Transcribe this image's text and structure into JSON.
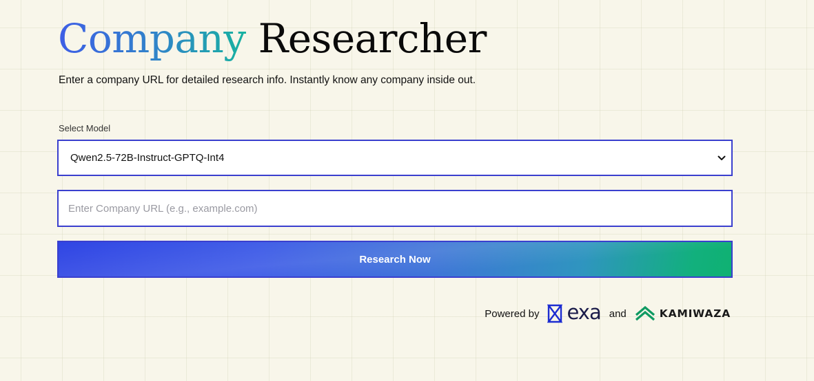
{
  "title": {
    "accent": "Company",
    "main": "Researcher"
  },
  "subtitle": "Enter a company URL for detailed research info. Instantly know any company inside out.",
  "model_select": {
    "label": "Select Model",
    "selected": "Qwen2.5-72B-Instruct-GPTQ-Int4"
  },
  "url_input": {
    "value": "",
    "placeholder": "Enter Company URL (e.g., example.com)"
  },
  "research_button": {
    "label": "Research Now"
  },
  "footer": {
    "powered_by": "Powered by",
    "exa_wordmark": "exa",
    "and": "and",
    "kamiwaza_wordmark": "KAMIWAZA"
  },
  "icons": {
    "select_chevron": "chevron-down-icon",
    "exa_logo": "exa-logo-icon",
    "kamiwaza_logo": "kamiwaza-logo-icon"
  },
  "colors": {
    "background": "#f8f6ea",
    "border_accent": "#3a3fce",
    "title_gradient_start": "#3e5ee6",
    "title_gradient_end": "#17b2a0",
    "button_gradient_start": "#2f45e4",
    "button_gradient_end": "#0fb172",
    "exa_brand": "#1c2cd1",
    "kamiwaza_brand": "#0f9a62"
  }
}
